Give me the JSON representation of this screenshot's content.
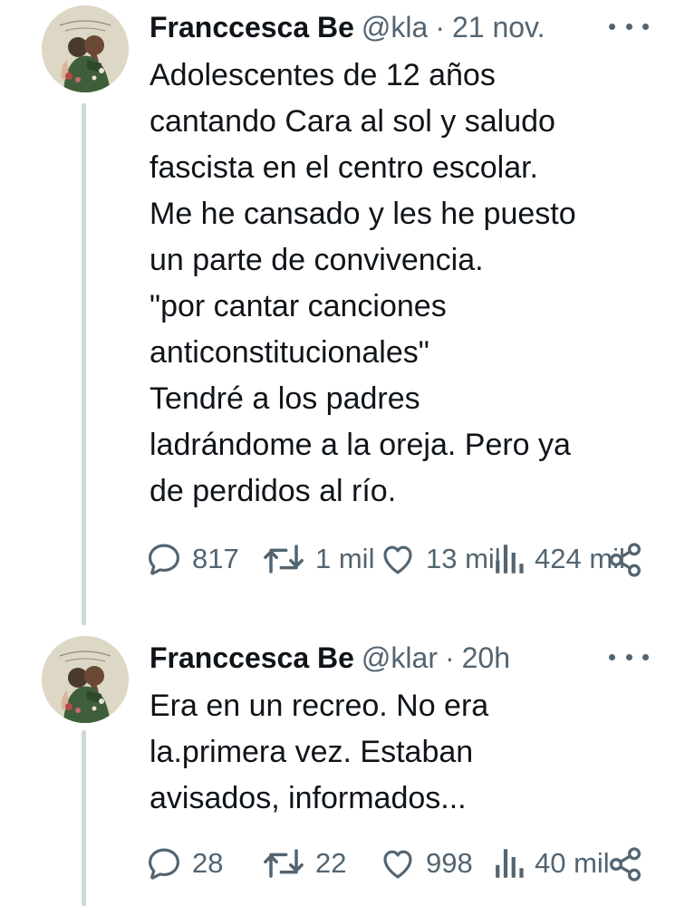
{
  "tweets": [
    {
      "author_name": "Franccesca Be",
      "handle": "@kla",
      "time": "21 nov.",
      "text": "Adolescentes de 12 años\ncantando Cara al sol y saludo\nfascista en el centro escolar.\nMe he cansado y les he puesto\nun parte de convivencia.\n\"por cantar canciones\nanticonstitucionales\"\nTendré a los padres\nladrándome a la oreja. Pero ya\nde perdidos al río.",
      "replies": "817",
      "retweets": "1 mil",
      "likes": "13 mil",
      "views": "424 mil"
    },
    {
      "author_name": "Franccesca Be",
      "handle": "@klar",
      "time": "20h",
      "text": "Era en un recreo. No era\nla.primera vez. Estaban\navisados, informados...",
      "replies": "28",
      "retweets": "22",
      "likes": "998",
      "views": "40 mil"
    }
  ],
  "icons": {
    "reply": "reply-icon",
    "retweet": "retweet-icon",
    "like": "heart-icon",
    "views": "views-icon",
    "share": "share-icon",
    "more": "more-icon"
  },
  "colors": {
    "text_primary": "#0f1419",
    "text_secondary": "#536471",
    "thread_line": "#cfd9de"
  }
}
